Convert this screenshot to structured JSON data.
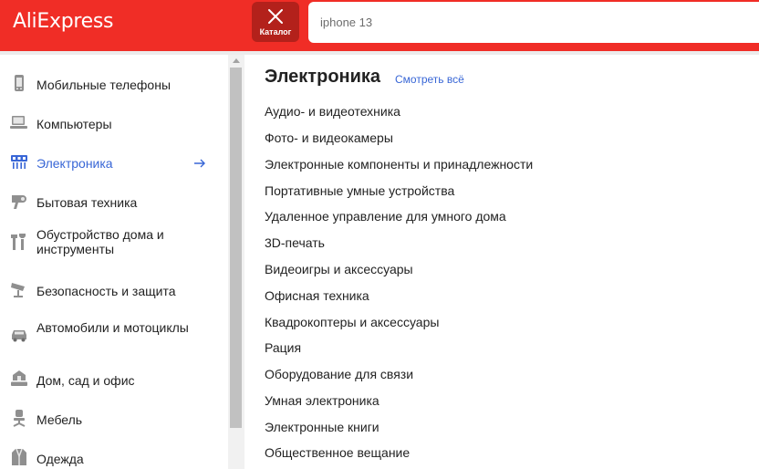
{
  "header": {
    "logo": "AliExpress",
    "catalog_label": "Каталог",
    "search_value": "iphone 13"
  },
  "colors": {
    "brand_red": "#f02d26",
    "accent_blue": "#3866d6"
  },
  "sidebar": {
    "items": [
      {
        "label": "Мобильные телефоны",
        "icon": "mobile-phone-icon"
      },
      {
        "label": "Компьютеры",
        "icon": "computer-icon"
      },
      {
        "label": "Электроника",
        "icon": "electronics-icon",
        "active": true
      },
      {
        "label": "Бытовая техника",
        "icon": "hair-dryer-icon"
      },
      {
        "label": "Обустройство дома и инструменты",
        "icon": "tools-icon"
      },
      {
        "label": "Безопасность и защита",
        "icon": "security-camera-icon"
      },
      {
        "label": "Автомобили и мотоциклы",
        "icon": "car-icon"
      },
      {
        "label": "Дом, сад и офис",
        "icon": "house-icon"
      },
      {
        "label": "Мебель",
        "icon": "chair-icon"
      },
      {
        "label": "Одежда",
        "icon": "clothing-icon"
      }
    ]
  },
  "content": {
    "title": "Электроника",
    "see_all": "Смотреть всё",
    "subcategories": [
      "Аудио- и видеотехника",
      "Фото- и видеокамеры",
      "Электронные компоненты и принадлежности",
      "Портативные умные устройства",
      "Удаленное управление для умного дома",
      "3D-печать",
      "Видеоигры и аксессуары",
      "Офисная техника",
      "Квадрокоптеры и аксессуары",
      "Рация",
      "Оборудование для связи",
      "Умная электроника",
      "Электронные книги",
      "Общественное вещание"
    ]
  }
}
